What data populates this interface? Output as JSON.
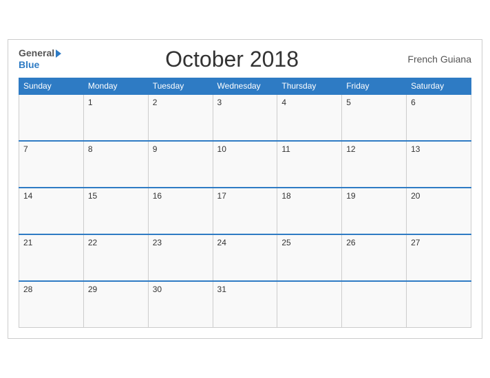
{
  "header": {
    "logo_general": "General",
    "logo_blue": "Blue",
    "title": "October 2018",
    "region": "French Guiana"
  },
  "days_header": [
    "Sunday",
    "Monday",
    "Tuesday",
    "Wednesday",
    "Thursday",
    "Friday",
    "Saturday"
  ],
  "weeks": [
    [
      "",
      "1",
      "2",
      "3",
      "4",
      "5",
      "6"
    ],
    [
      "7",
      "8",
      "9",
      "10",
      "11",
      "12",
      "13"
    ],
    [
      "14",
      "15",
      "16",
      "17",
      "18",
      "19",
      "20"
    ],
    [
      "21",
      "22",
      "23",
      "24",
      "25",
      "26",
      "27"
    ],
    [
      "28",
      "29",
      "30",
      "31",
      "",
      "",
      ""
    ]
  ]
}
